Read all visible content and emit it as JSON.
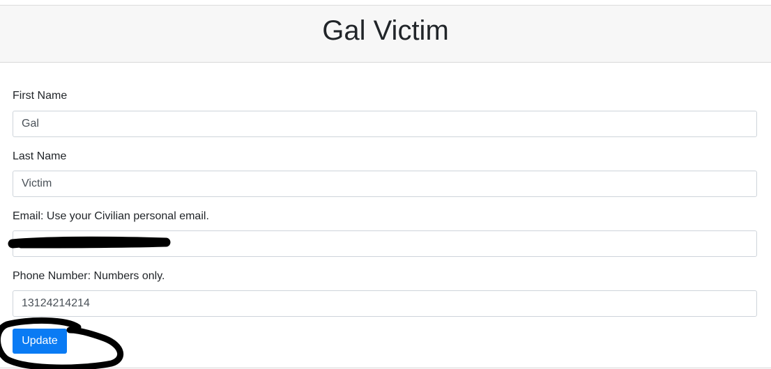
{
  "header": {
    "title": "Gal Victim"
  },
  "form": {
    "first_name": {
      "label": "First Name",
      "value": "Gal"
    },
    "last_name": {
      "label": "Last Name",
      "value": "Victim"
    },
    "email": {
      "label": "Email: Use your Civilian personal email.",
      "value": ""
    },
    "phone": {
      "label": "Phone Number: Numbers only.",
      "value": "13124214214"
    },
    "update_label": "Update"
  },
  "colors": {
    "header_bg": "#f7f7f7",
    "primary_button": "#0a7bf4",
    "redaction_ink": "#000000"
  }
}
